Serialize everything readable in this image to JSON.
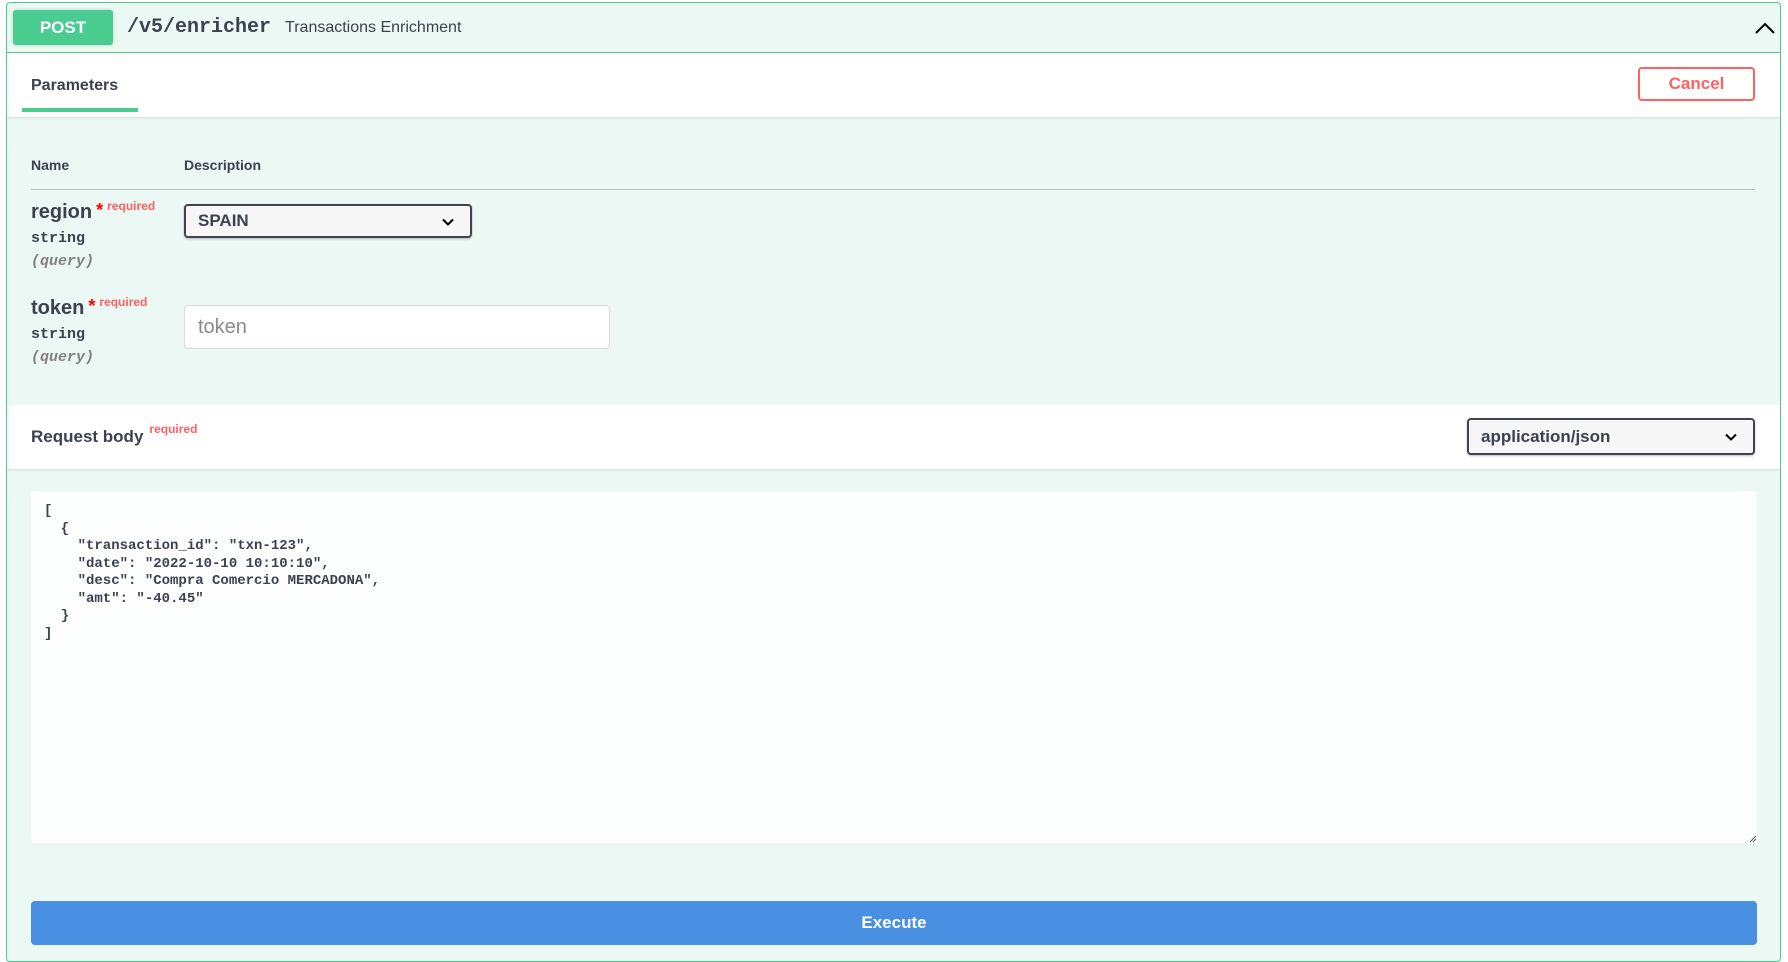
{
  "operation": {
    "method": "POST",
    "path": "/v5/enricher",
    "summary": "Transactions Enrichment"
  },
  "tabs": {
    "parameters_label": "Parameters",
    "cancel_label": "Cancel"
  },
  "params_table": {
    "name_header": "Name",
    "description_header": "Description",
    "required_marker": "*",
    "required_label": "required",
    "rows": [
      {
        "name": "region",
        "type": "string",
        "in": "(query)",
        "value": "SPAIN"
      },
      {
        "name": "token",
        "type": "string",
        "in": "(query)",
        "placeholder": "token"
      }
    ]
  },
  "request_body": {
    "title": "Request body",
    "required_label": "required",
    "content_type": "application/json",
    "json_text": "[\n  {\n    \"transaction_id\": \"txn-123\",\n    \"date\": \"2022-10-10 10:10:10\",\n    \"desc\": \"Compra Comercio MERCADONA\",\n    \"amt\": \"-40.45\"\n  }\n]"
  },
  "execute_label": "Execute",
  "icons": {
    "collapse": "chevron-up-icon",
    "select_arrow": "chevron-down-icon",
    "resize": "resize-grip-icon"
  },
  "colors": {
    "post_green": "#49cc90",
    "cancel_red": "#ff6060",
    "execute_blue": "#4990e2",
    "block_bg": "#ecf8f3"
  }
}
